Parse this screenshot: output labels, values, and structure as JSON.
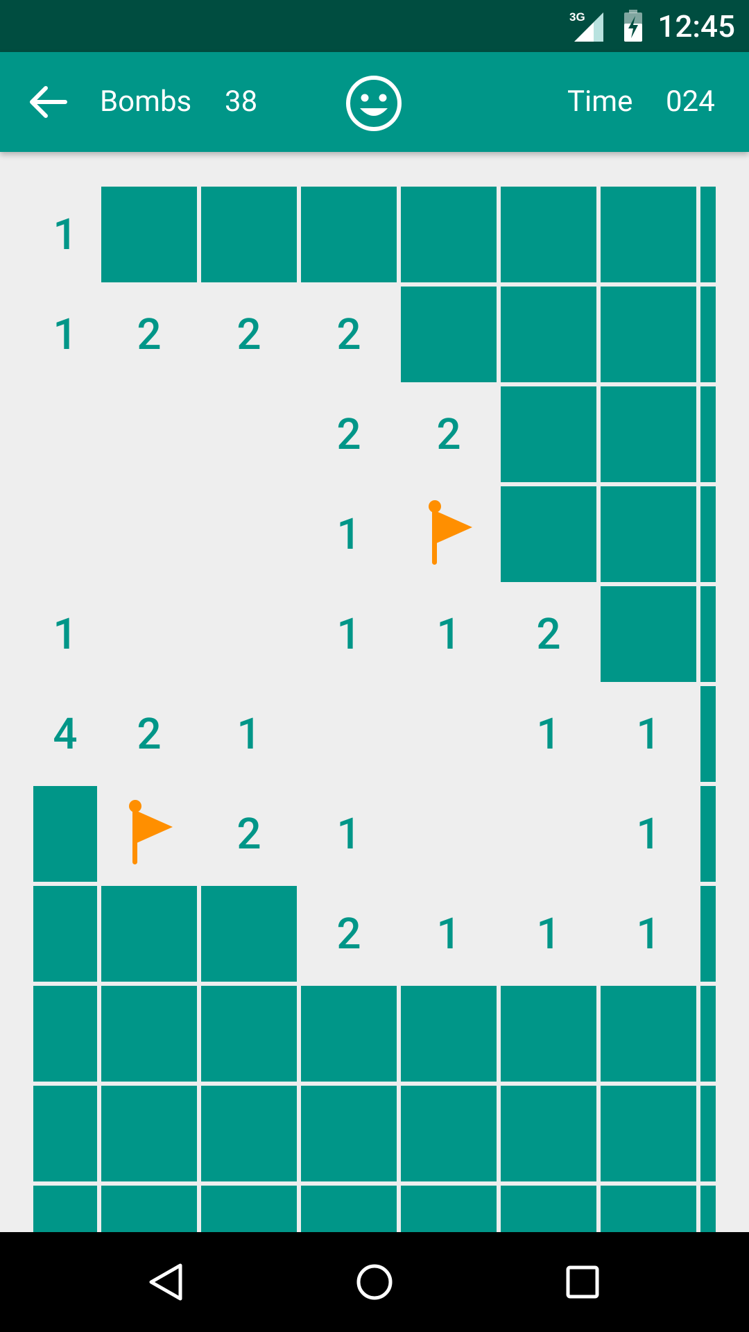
{
  "status_bar": {
    "time": "12:45",
    "network_label": "3G",
    "icons": [
      "signal-icon",
      "battery-charging-icon"
    ]
  },
  "app_bar": {
    "back_icon": "arrow-left-icon",
    "bombs_label": "Bombs",
    "bombs_value": "38",
    "smiley_icon": "smiley-face-icon",
    "time_label": "Time",
    "time_value": "024"
  },
  "colors": {
    "primary": "#009688",
    "status_bar": "#004d40",
    "flag": "#ff8f00",
    "board_background": "#eeeeee"
  },
  "board": {
    "cell_legend": {
      "C": "covered",
      "F": "flag",
      "": "empty-revealed",
      "digits": "adjacent bomb count"
    },
    "rows": [
      [
        "1",
        "C",
        "C",
        "C",
        "C",
        "C",
        "C",
        "C"
      ],
      [
        "1",
        "2",
        "2",
        "2",
        "C",
        "C",
        "C",
        "C"
      ],
      [
        "",
        "",
        "",
        "2",
        "2",
        "C",
        "C",
        "C"
      ],
      [
        "",
        "",
        "",
        "1",
        "F",
        "C",
        "C",
        "C"
      ],
      [
        "1",
        "",
        "",
        "1",
        "1",
        "2",
        "C",
        "C"
      ],
      [
        "4",
        "2",
        "1",
        "",
        "",
        "1",
        "1",
        "C"
      ],
      [
        "C",
        "F",
        "2",
        "1",
        "",
        "",
        "1",
        "C"
      ],
      [
        "C",
        "C",
        "C",
        "2",
        "1",
        "1",
        "1",
        "C"
      ],
      [
        "C",
        "C",
        "C",
        "C",
        "C",
        "C",
        "C",
        "C"
      ],
      [
        "C",
        "C",
        "C",
        "C",
        "C",
        "C",
        "C",
        "C"
      ],
      [
        "C",
        "C",
        "C",
        "C",
        "C",
        "C",
        "C",
        "C"
      ]
    ]
  },
  "nav_bar": {
    "buttons": [
      "back-triangle-icon",
      "home-circle-icon",
      "recents-square-icon"
    ]
  }
}
